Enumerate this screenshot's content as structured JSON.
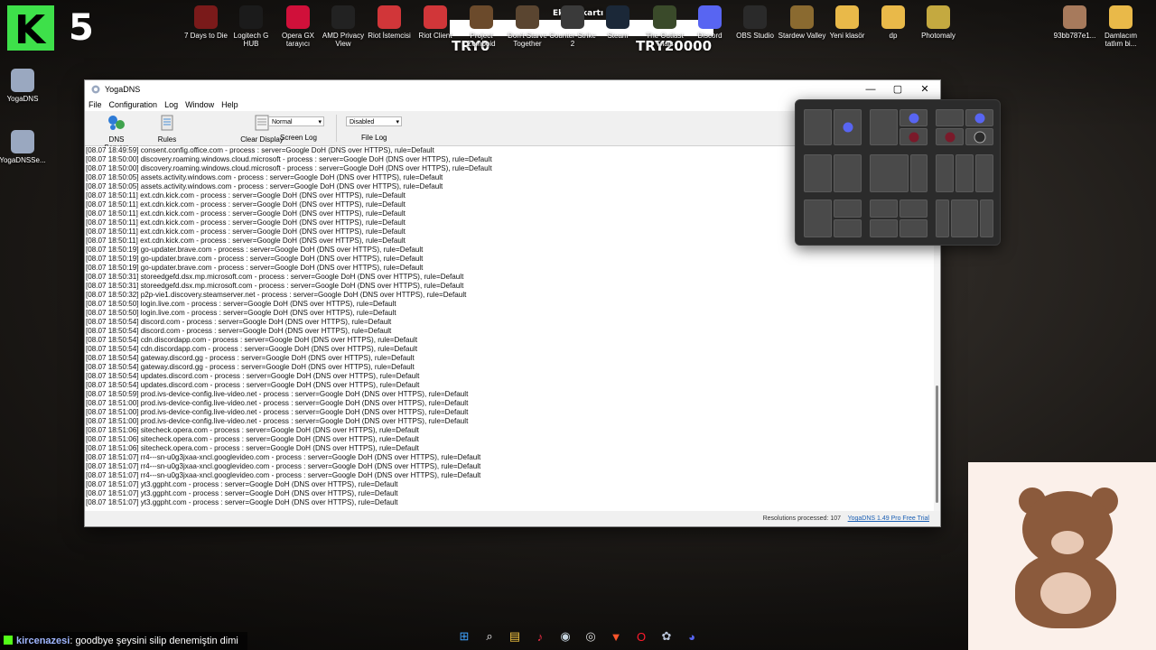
{
  "stream": {
    "logo_letter": "K",
    "count": "5",
    "try_left": "TRY0",
    "try_right": "TRY20000",
    "banner_text": "Ekran kartı"
  },
  "desktop_icons_top": [
    {
      "label": "7 Days to Die",
      "color": "#7a1a1a"
    },
    {
      "label": "Logitech G HUB",
      "color": "#1b1b1b"
    },
    {
      "label": "Opera GX tarayıcı",
      "color": "#d0103a"
    },
    {
      "label": "AMD Privacy View",
      "color": "#222222"
    },
    {
      "label": "Riot İstemcisi",
      "color": "#d13639"
    },
    {
      "label": "Riot Client",
      "color": "#d13639"
    },
    {
      "label": "Project Zomboid",
      "color": "#6b4a2b"
    },
    {
      "label": "Don't Starve Together",
      "color": "#5a4530"
    },
    {
      "label": "Counter-Strike 2",
      "color": "#3a3a3a"
    },
    {
      "label": "Steam",
      "color": "#1b2838"
    },
    {
      "label": "The Outlast Trials",
      "color": "#3a4a2a"
    },
    {
      "label": "Discord",
      "color": "#5865f2"
    },
    {
      "label": "OBS Studio",
      "color": "#2a2a2a"
    },
    {
      "label": "Stardew Valley",
      "color": "#8a6a30"
    },
    {
      "label": "Yeni klasör",
      "color": "#e9b949"
    },
    {
      "label": "dp",
      "color": "#e9b949"
    },
    {
      "label": "Photomaly",
      "color": "#c4a940"
    }
  ],
  "desktop_icons_right": [
    {
      "label": "93bb787e1...",
      "color": "#a77a5c"
    },
    {
      "label": "Damlacım tatlım bi...",
      "color": "#e9b949"
    }
  ],
  "desktop_icons_left": [
    {
      "label": "YogaDNS",
      "color": "#9aa8c0"
    },
    {
      "label": "YogaDNSSe...",
      "color": "#9aa8c0"
    }
  ],
  "window": {
    "title": "YogaDNS",
    "menu": [
      "File",
      "Configuration",
      "Log",
      "Window",
      "Help"
    ],
    "toolbar": {
      "dns_servers": "DNS Servers",
      "rules": "Rules",
      "clear_display": "Clear Display",
      "screen_log_value": "Normal",
      "screen_log": "Screen Log",
      "file_log_value": "Disabled",
      "file_log": "File Log"
    },
    "log_lines": [
      "[08.07 18:49:59] consent.config.office.com - process : server=Google DoH (DNS over HTTPS), rule=Default",
      "[08.07 18:50:00] discovery.roaming.windows.cloud.microsoft - process : server=Google DoH (DNS over HTTPS), rule=Default",
      "[08.07 18:50:00] discovery.roaming.windows.cloud.microsoft - process : server=Google DoH (DNS over HTTPS), rule=Default",
      "[08.07 18:50:05] assets.activity.windows.com - process : server=Google DoH (DNS over HTTPS), rule=Default",
      "[08.07 18:50:05] assets.activity.windows.com - process : server=Google DoH (DNS over HTTPS), rule=Default",
      "[08.07 18:50:11] ext.cdn.kick.com - process : server=Google DoH (DNS over HTTPS), rule=Default",
      "[08.07 18:50:11] ext.cdn.kick.com - process : server=Google DoH (DNS over HTTPS), rule=Default",
      "[08.07 18:50:11] ext.cdn.kick.com - process : server=Google DoH (DNS over HTTPS), rule=Default",
      "[08.07 18:50:11] ext.cdn.kick.com - process : server=Google DoH (DNS over HTTPS), rule=Default",
      "[08.07 18:50:11] ext.cdn.kick.com - process : server=Google DoH (DNS over HTTPS), rule=Default",
      "[08.07 18:50:11] ext.cdn.kick.com - process : server=Google DoH (DNS over HTTPS), rule=Default",
      "[08.07 18:50:19] go-updater.brave.com - process : server=Google DoH (DNS over HTTPS), rule=Default",
      "[08.07 18:50:19] go-updater.brave.com - process : server=Google DoH (DNS over HTTPS), rule=Default",
      "[08.07 18:50:19] go-updater.brave.com - process : server=Google DoH (DNS over HTTPS), rule=Default",
      "[08.07 18:50:31] storeedgefd.dsx.mp.microsoft.com - process : server=Google DoH (DNS over HTTPS), rule=Default",
      "[08.07 18:50:31] storeedgefd.dsx.mp.microsoft.com - process : server=Google DoH (DNS over HTTPS), rule=Default",
      "[08.07 18:50:32] p2p-vie1.discovery.steamserver.net - process : server=Google DoH (DNS over HTTPS), rule=Default",
      "[08.07 18:50:50] login.live.com - process : server=Google DoH (DNS over HTTPS), rule=Default",
      "[08.07 18:50:50] login.live.com - process : server=Google DoH (DNS over HTTPS), rule=Default",
      "[08.07 18:50:54] discord.com - process : server=Google DoH (DNS over HTTPS), rule=Default",
      "[08.07 18:50:54] discord.com - process : server=Google DoH (DNS over HTTPS), rule=Default",
      "[08.07 18:50:54] cdn.discordapp.com - process : server=Google DoH (DNS over HTTPS), rule=Default",
      "[08.07 18:50:54] cdn.discordapp.com - process : server=Google DoH (DNS over HTTPS), rule=Default",
      "[08.07 18:50:54] gateway.discord.gg - process : server=Google DoH (DNS over HTTPS), rule=Default",
      "[08.07 18:50:54] gateway.discord.gg - process : server=Google DoH (DNS over HTTPS), rule=Default",
      "[08.07 18:50:54] updates.discord.com - process : server=Google DoH (DNS over HTTPS), rule=Default",
      "[08.07 18:50:54] updates.discord.com - process : server=Google DoH (DNS over HTTPS), rule=Default",
      "[08.07 18:50:59] prod.ivs-device-config.live-video.net - process : server=Google DoH (DNS over HTTPS), rule=Default",
      "[08.07 18:51:00] prod.ivs-device-config.live-video.net - process : server=Google DoH (DNS over HTTPS), rule=Default",
      "[08.07 18:51:00] prod.ivs-device-config.live-video.net - process : server=Google DoH (DNS over HTTPS), rule=Default",
      "[08.07 18:51:00] prod.ivs-device-config.live-video.net - process : server=Google DoH (DNS over HTTPS), rule=Default",
      "[08.07 18:51:06] sitecheck.opera.com - process : server=Google DoH (DNS over HTTPS), rule=Default",
      "[08.07 18:51:06] sitecheck.opera.com - process : server=Google DoH (DNS over HTTPS), rule=Default",
      "[08.07 18:51:06] sitecheck.opera.com - process : server=Google DoH (DNS over HTTPS), rule=Default",
      "[08.07 18:51:07] rr4---sn-u0g3jxaa-xncl.googlevideo.com - process : server=Google DoH (DNS over HTTPS), rule=Default",
      "[08.07 18:51:07] rr4---sn-u0g3jxaa-xncl.googlevideo.com - process : server=Google DoH (DNS over HTTPS), rule=Default",
      "[08.07 18:51:07] rr4---sn-u0g3jxaa-xncl.googlevideo.com - process : server=Google DoH (DNS over HTTPS), rule=Default",
      "[08.07 18:51:07] yt3.ggpht.com - process : server=Google DoH (DNS over HTTPS), rule=Default",
      "[08.07 18:51:07] yt3.ggpht.com - process : server=Google DoH (DNS over HTTPS), rule=Default",
      "[08.07 18:51:07] yt3.ggpht.com - process : server=Google DoH (DNS over HTTPS), rule=Default"
    ],
    "status": {
      "resolutions": "Resolutions processed: 107",
      "version": "YogaDNS 1.49 Pro Free Trial"
    }
  },
  "chat": {
    "user": "kircenazesi",
    "message": ": goodbye şeysini silip denemiştin dimi"
  },
  "taskbar": [
    {
      "name": "start-icon",
      "glyph": "⊞",
      "color": "#3fa3ff"
    },
    {
      "name": "search-icon",
      "glyph": "⌕",
      "color": "#ffffff"
    },
    {
      "name": "file-explorer-icon",
      "glyph": "▤",
      "color": "#f4c542"
    },
    {
      "name": "music-icon",
      "glyph": "♪",
      "color": "#fa2d48"
    },
    {
      "name": "steam-icon",
      "glyph": "◉",
      "color": "#c7d5e0"
    },
    {
      "name": "chrome-icon",
      "glyph": "◎",
      "color": "#dddddd"
    },
    {
      "name": "brave-icon",
      "glyph": "▼",
      "color": "#fb542b"
    },
    {
      "name": "opera-icon",
      "glyph": "O",
      "color": "#ff1b2d"
    },
    {
      "name": "yogadns-icon",
      "glyph": "✿",
      "color": "#b8c4d8"
    },
    {
      "name": "discord-icon",
      "glyph": "◕",
      "color": "#5865f2"
    }
  ]
}
